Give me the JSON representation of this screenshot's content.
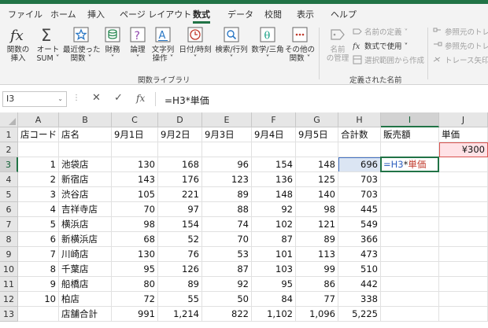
{
  "menu": {
    "tabs": [
      "ファイル",
      "ホーム",
      "挿入",
      "ページ レイアウト",
      "数式",
      "データ",
      "校閲",
      "表示",
      "ヘルプ"
    ],
    "active": "数式"
  },
  "ribbon": {
    "function_library": {
      "buttons": [
        {
          "label1": "関数の",
          "label2": "挿入"
        },
        {
          "label1": "オート",
          "label2": "SUM ˅"
        },
        {
          "label1": "最近使った",
          "label2": "関数 ˅"
        },
        {
          "label1": "財務",
          "label2": "˅"
        },
        {
          "label1": "論理",
          "label2": "˅"
        },
        {
          "label1": "文字列",
          "label2": "操作 ˅"
        },
        {
          "label1": "日付/時刻",
          "label2": "˅"
        },
        {
          "label1": "検索/行列",
          "label2": "˅"
        },
        {
          "label1": "数学/三角",
          "label2": "˅"
        },
        {
          "label1": "その他の",
          "label2": "関数 ˅"
        }
      ],
      "group_label": "関数ライブラリ"
    },
    "defined_names": {
      "name_manager_1": "名前",
      "name_manager_2": "の管理",
      "define_name": "名前の定義 ˅",
      "use_in_formula": "数式で使用 ˅",
      "create_from_selection": "選択範囲から作成",
      "group_label": "定義された名前"
    },
    "formula_auditing": {
      "trace_precedents": "参照元のトレ",
      "trace_dependents": "参照先のトレ",
      "remove_arrows": "トレース矢印の"
    }
  },
  "formula_bar": {
    "name_box": "I3",
    "cancel": "✕",
    "enter": "✓",
    "fx": "fx",
    "formula": "=H3*単価"
  },
  "sheet": {
    "columns": [
      "A",
      "B",
      "C",
      "D",
      "E",
      "F",
      "G",
      "H",
      "I",
      "J"
    ],
    "selected_column": "I",
    "selected_row": "3",
    "rows": [
      {
        "n": "1",
        "cells": [
          "店コード",
          "店名",
          "9月1日",
          "9月2日",
          "9月3日",
          "9月4日",
          "9月5日",
          "合計数",
          "販売額",
          "単価"
        ]
      },
      {
        "n": "2",
        "cells": [
          "",
          "",
          "",
          "",
          "",
          "",
          "",
          "",
          "",
          "¥300"
        ]
      },
      {
        "n": "3",
        "cells": [
          "1",
          "池袋店",
          "130",
          "168",
          "96",
          "154",
          "148",
          "696",
          "",
          ""
        ]
      },
      {
        "n": "4",
        "cells": [
          "2",
          "新宿店",
          "143",
          "176",
          "123",
          "136",
          "125",
          "703",
          "",
          ""
        ]
      },
      {
        "n": "5",
        "cells": [
          "3",
          "渋谷店",
          "105",
          "221",
          "89",
          "148",
          "140",
          "703",
          "",
          ""
        ]
      },
      {
        "n": "6",
        "cells": [
          "4",
          "吉祥寺店",
          "70",
          "97",
          "88",
          "92",
          "98",
          "445",
          "",
          ""
        ]
      },
      {
        "n": "7",
        "cells": [
          "5",
          "横浜店",
          "98",
          "154",
          "74",
          "102",
          "121",
          "549",
          "",
          ""
        ]
      },
      {
        "n": "8",
        "cells": [
          "6",
          "新横浜店",
          "68",
          "52",
          "70",
          "87",
          "89",
          "366",
          "",
          ""
        ]
      },
      {
        "n": "9",
        "cells": [
          "7",
          "川崎店",
          "130",
          "76",
          "53",
          "101",
          "113",
          "473",
          "",
          ""
        ]
      },
      {
        "n": "10",
        "cells": [
          "8",
          "千葉店",
          "95",
          "126",
          "87",
          "103",
          "99",
          "510",
          "",
          ""
        ]
      },
      {
        "n": "11",
        "cells": [
          "9",
          "船橋店",
          "80",
          "89",
          "92",
          "95",
          "86",
          "442",
          "",
          ""
        ]
      },
      {
        "n": "12",
        "cells": [
          "10",
          "柏店",
          "72",
          "55",
          "50",
          "84",
          "77",
          "338",
          "",
          ""
        ]
      },
      {
        "n": "13",
        "cells": [
          "",
          "店舗合計",
          "991",
          "1,214",
          "822",
          "1,102",
          "1,096",
          "5,225",
          "",
          ""
        ]
      }
    ],
    "editing": {
      "ref1": "=H3",
      "op": "*",
      "ref2": "単価"
    }
  },
  "colors": {
    "accent": "#217346",
    "ref_blue": "#4472c4",
    "ref_red": "#d9534f"
  }
}
